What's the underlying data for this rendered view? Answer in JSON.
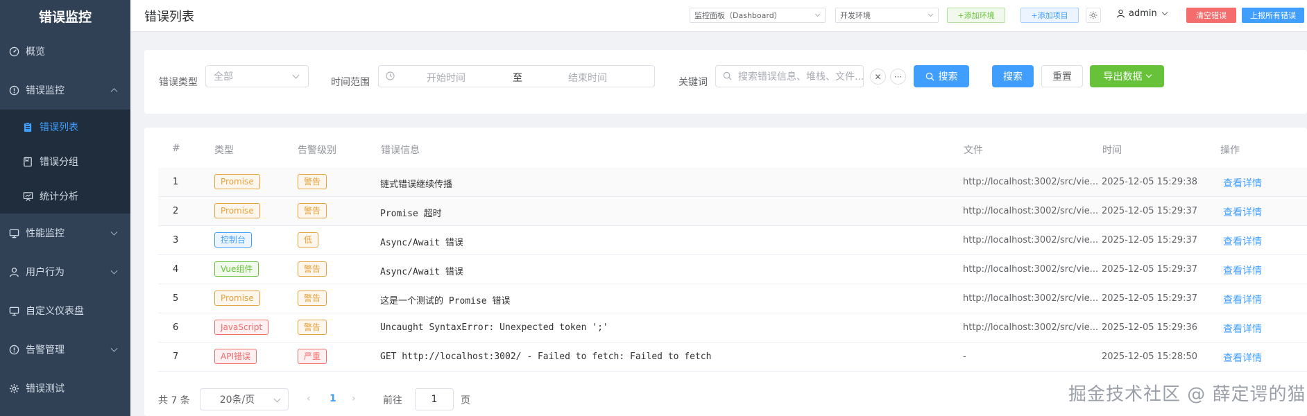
{
  "sidebar": {
    "logo": "错误监控",
    "items": [
      {
        "label": "概览",
        "icon": "dashboard-icon"
      },
      {
        "label": "错误监控",
        "icon": "warning-circle-icon",
        "expanded": true,
        "children": [
          {
            "label": "错误列表",
            "icon": "document-icon",
            "active": true
          },
          {
            "label": "错误分组",
            "icon": "folder-icon"
          },
          {
            "label": "统计分析",
            "icon": "chart-icon"
          }
        ]
      },
      {
        "label": "性能监控",
        "icon": "monitor-icon"
      },
      {
        "label": "用户行为",
        "icon": "user-icon"
      },
      {
        "label": "自定义仪表盘",
        "icon": "monitor-icon"
      },
      {
        "label": "告警管理",
        "icon": "alarm-icon"
      },
      {
        "label": "错误测试",
        "icon": "gear-icon"
      }
    ]
  },
  "header": {
    "title": "错误列表",
    "dashboard_select": "监控面板（Dashboard）",
    "env_select": "开发环境",
    "add_env": "添加环境",
    "add_project": "添加项目",
    "user": "admin",
    "clear_errors": "清空错误",
    "report_all": "上报所有错误"
  },
  "filters": {
    "type_label": "错误类型",
    "type_value": "全部",
    "time_label": "时间范围",
    "start_placeholder": "开始时间",
    "range_sep": "至",
    "end_placeholder": "结束时间",
    "keyword_label": "关键词",
    "keyword_placeholder": "搜索错误信息、堆栈、文件...",
    "search_inline": "搜索",
    "search": "搜索",
    "reset": "重置",
    "export": "导出数据"
  },
  "table": {
    "columns": [
      "#",
      "类型",
      "告警级别",
      "错误信息",
      "文件",
      "时间",
      "操作"
    ],
    "rows": [
      {
        "idx": "1",
        "type": "Promise",
        "type_style": "warn",
        "level": "警告",
        "level_style": "warn",
        "msg": "链式错误继续传播",
        "file": "http://localhost:3002/src/vie...",
        "time": "2025-12-05 15:29:38",
        "action": "查看详情"
      },
      {
        "idx": "2",
        "type": "Promise",
        "type_style": "warn",
        "level": "警告",
        "level_style": "warn",
        "msg": "Promise 超时",
        "file": "http://localhost:3002/src/vie...",
        "time": "2025-12-05 15:29:37",
        "action": "查看详情"
      },
      {
        "idx": "3",
        "type": "控制台",
        "type_style": "info",
        "level": "低",
        "level_style": "warn",
        "msg": "Async/Await 错误",
        "file": "http://localhost:3002/src/vie...",
        "time": "2025-12-05 15:29:37",
        "action": "查看详情"
      },
      {
        "idx": "4",
        "type": "Vue组件",
        "type_style": "success",
        "level": "警告",
        "level_style": "warn",
        "msg": "Async/Await 错误",
        "file": "http://localhost:3002/src/vie...",
        "time": "2025-12-05 15:29:37",
        "action": "查看详情"
      },
      {
        "idx": "5",
        "type": "Promise",
        "type_style": "warn",
        "level": "警告",
        "level_style": "warn",
        "msg": "这是一个测试的 Promise 错误",
        "file": "http://localhost:3002/src/vie...",
        "time": "2025-12-05 15:29:37",
        "action": "查看详情"
      },
      {
        "idx": "6",
        "type": "JavaScript",
        "type_style": "danger",
        "level": "警告",
        "level_style": "warn",
        "msg": "Uncaught SyntaxError: Unexpected token ';'",
        "file": "http://localhost:3002/src/vie...",
        "time": "2025-12-05 15:29:36",
        "action": "查看详情"
      },
      {
        "idx": "7",
        "type": "API错误",
        "type_style": "danger",
        "level": "严重",
        "level_style": "danger",
        "msg": "GET http://localhost:3002/ - Failed to fetch: Failed to fetch",
        "file": "-",
        "time": "2025-12-05 15:28:50",
        "action": "查看详情"
      }
    ]
  },
  "pagination": {
    "total": "共 7 条",
    "page_size": "20条/页",
    "current": "1",
    "goto_label": "前往",
    "goto_value": "1",
    "page_suffix": "页"
  },
  "watermark": "掘金技术社区 @ 薛定谔的猫_"
}
